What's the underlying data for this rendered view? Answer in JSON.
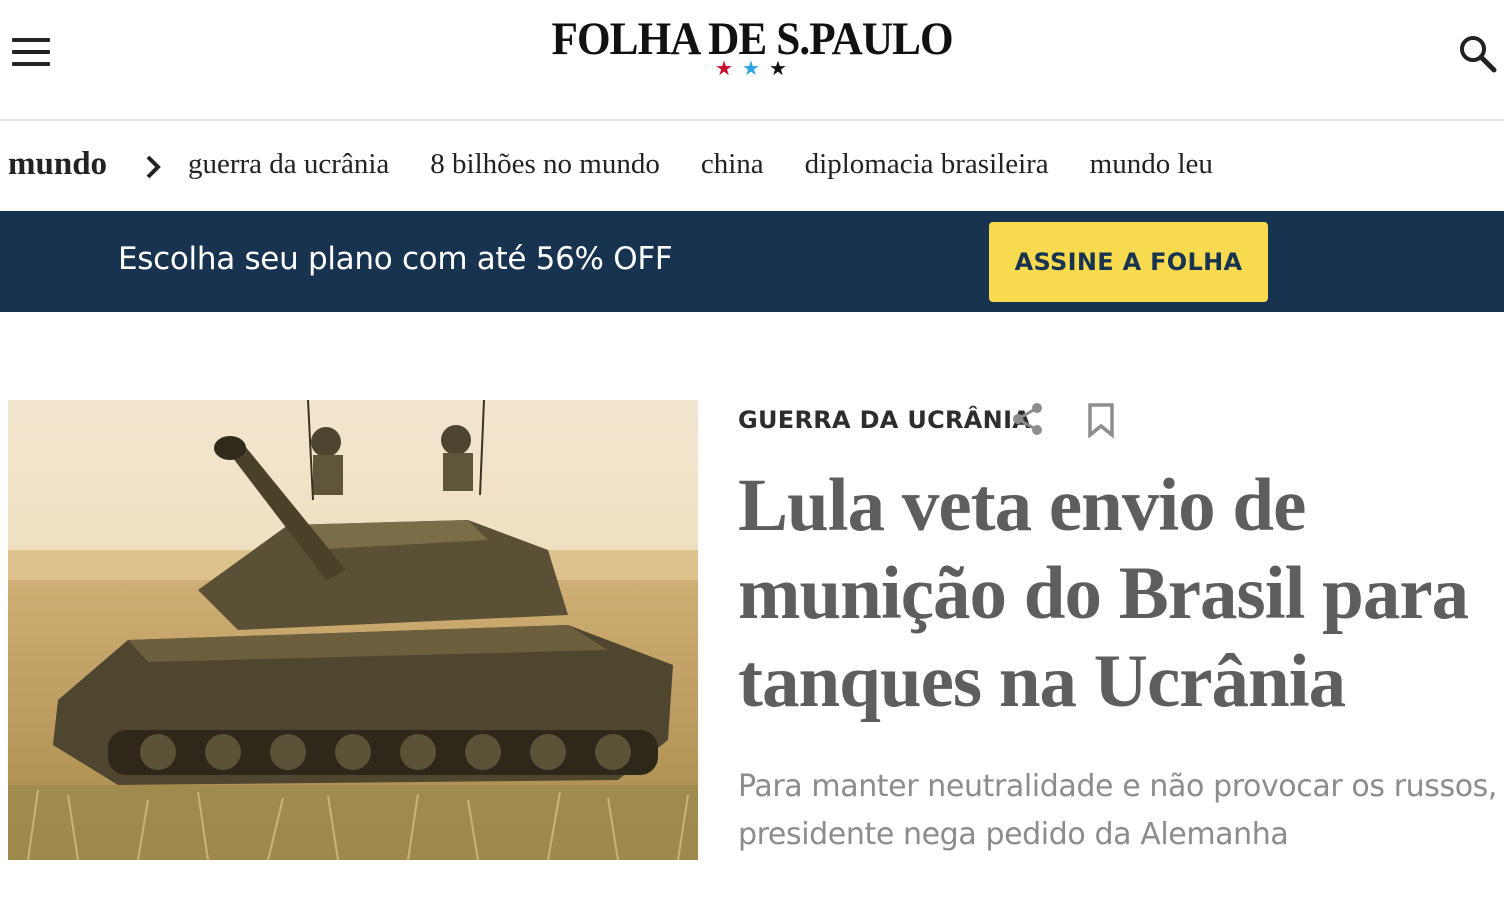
{
  "header": {
    "logo": "FOLHA DE S.PAULO",
    "stars": [
      "★",
      "★",
      "★"
    ],
    "menu_icon": "hamburger-menu-icon",
    "search_icon": "search-icon"
  },
  "subnav": {
    "section": "mundo",
    "chevron_icon": "chevron-right-icon",
    "links": [
      "guerra da ucrânia",
      "8 bilhões no mundo",
      "china",
      "diplomacia brasileira",
      "mundo leu"
    ]
  },
  "promo": {
    "text": "Escolha seu plano com até 56% OFF",
    "button": "ASSINE A FOLHA",
    "background_color": "#17334f",
    "button_color": "#f8da4e"
  },
  "article": {
    "image": "tank-with-soldiers-photo",
    "kicker": "GUERRA DA UCRÂNIA",
    "share_icon": "share-icon",
    "bookmark_icon": "bookmark-icon",
    "headline": "Lula veta envio de munição do Brasil para tanques na Ucrânia",
    "standfirst": "Para manter neutralidade e não provocar os russos, presidente nega pedido da Alemanha"
  }
}
